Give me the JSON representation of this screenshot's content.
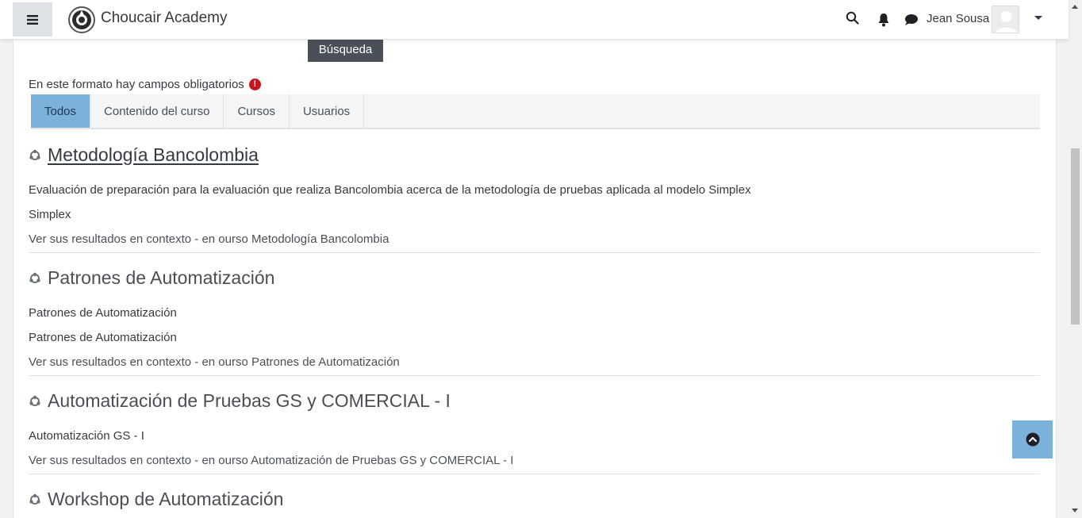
{
  "navbar": {
    "brand": "Choucair Academy",
    "user_name": "Jean Sousa",
    "icons": [
      "hamburger-menu-icon",
      "search-icon",
      "bell-icon",
      "chat-icon",
      "user-avatar",
      "caret-down-icon"
    ]
  },
  "search": {
    "button_label": "Búsqueda"
  },
  "form": {
    "required_note": "En este formato hay campos obligatorios",
    "required_icon": "!"
  },
  "tabs": [
    {
      "label": "Todos",
      "active": true
    },
    {
      "label": "Contenido del curso",
      "active": false
    },
    {
      "label": "Cursos",
      "active": false
    },
    {
      "label": "Usuarios",
      "active": false
    }
  ],
  "results": [
    {
      "title": "Metodología Bancolombia",
      "lines": [
        "Evaluación de preparación para la evaluación que realiza Bancolombia acerca de la metodología de pruebas aplicada al modelo Simplex",
        "Simplex"
      ],
      "context": "Ver sus resultados en contexto - en ourso Metodología Bancolombia"
    },
    {
      "title": "Patrones de Automatización",
      "lines": [
        "Patrones de Automatización",
        "Patrones de Automatización"
      ],
      "context": "Ver sus resultados en contexto - en ourso Patrones de Automatización"
    },
    {
      "title": "Automatización de Pruebas GS y COMERCIAL - I",
      "lines": [
        "Automatización GS - I"
      ],
      "context": "Ver sus resultados en contexto - en ourso Automatización de Pruebas GS y COMERCIAL - I"
    },
    {
      "title": "Workshop de Automatización",
      "lines": [],
      "context": ""
    }
  ],
  "colors": {
    "active_tab": "#7cb1d9",
    "search_button": "#495057",
    "required_icon": "#c5161d"
  }
}
